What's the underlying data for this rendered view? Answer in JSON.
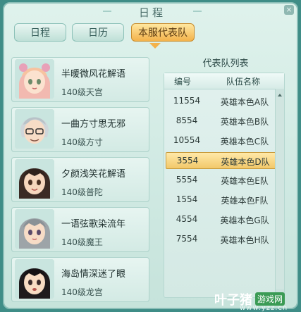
{
  "window": {
    "title": "日程",
    "close_label": "×"
  },
  "tabs": [
    {
      "label": "日程",
      "active": false
    },
    {
      "label": "日历",
      "active": false
    },
    {
      "label": "本服代表队",
      "active": true
    }
  ],
  "roster": [
    {
      "name": "半暖微风花解语",
      "level": "140级天宫",
      "avatar": "pink-hair-girl"
    },
    {
      "name": "一曲方寸思无邪",
      "level": "140级方寸",
      "avatar": "silver-hair-glasses"
    },
    {
      "name": "夕颜浅笑花解语",
      "level": "140级普陀",
      "avatar": "dark-hair-girl"
    },
    {
      "name": "一语弦歌染流年",
      "level": "140级魔王",
      "avatar": "grey-hair-girl"
    },
    {
      "name": "海岛情深迷了眼",
      "level": "140级龙宫",
      "avatar": "black-hair-girl"
    }
  ],
  "team_list": {
    "title": "代表队列表",
    "headers": [
      "编号",
      "队伍名称"
    ],
    "rows": [
      {
        "id": "11554",
        "name": "英雄本色A队",
        "selected": false
      },
      {
        "id": "8554",
        "name": "英雄本色B队",
        "selected": false
      },
      {
        "id": "10554",
        "name": "英雄本色C队",
        "selected": false
      },
      {
        "id": "3554",
        "name": "英雄本色D队",
        "selected": true
      },
      {
        "id": "5554",
        "name": "英雄本色E队",
        "selected": false
      },
      {
        "id": "1554",
        "name": "英雄本色F队",
        "selected": false
      },
      {
        "id": "4554",
        "name": "英雄本色G队",
        "selected": false
      },
      {
        "id": "7554",
        "name": "英雄本色H队",
        "selected": false
      }
    ]
  },
  "watermark": {
    "logo": "叶子猪",
    "brand": "游戏网",
    "url": "www.yzz.cn"
  }
}
